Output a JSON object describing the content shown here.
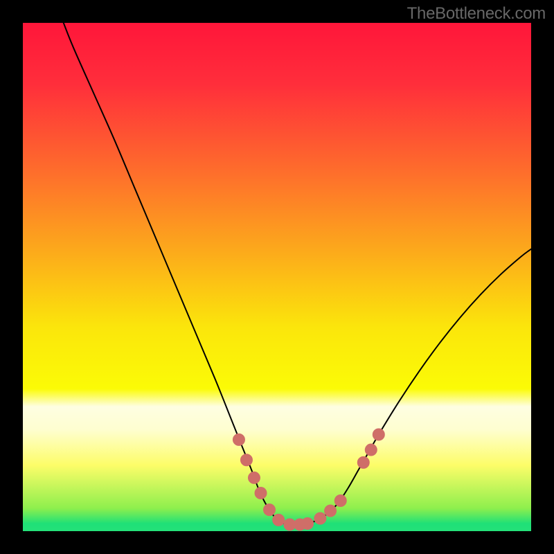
{
  "watermark": "TheBottleneck.com",
  "colors": {
    "frame": "#000000",
    "curve_stroke": "#000000",
    "marker_fill": "#cf6e68",
    "marker_stroke": "#cf6e68",
    "gradient_stops": [
      {
        "offset": 0.0,
        "color": "#ff163a"
      },
      {
        "offset": 0.12,
        "color": "#ff2e3b"
      },
      {
        "offset": 0.3,
        "color": "#fe702b"
      },
      {
        "offset": 0.46,
        "color": "#fcae1a"
      },
      {
        "offset": 0.6,
        "color": "#fbe60b"
      },
      {
        "offset": 0.72,
        "color": "#fbfb06"
      },
      {
        "offset": 0.755,
        "color": "#fefee2"
      },
      {
        "offset": 0.8,
        "color": "#fefed0"
      },
      {
        "offset": 0.87,
        "color": "#fdfd69"
      },
      {
        "offset": 0.955,
        "color": "#8eef4d"
      },
      {
        "offset": 0.985,
        "color": "#1fe077"
      },
      {
        "offset": 1.0,
        "color": "#24e179"
      }
    ]
  },
  "chart_data": {
    "type": "line",
    "title": "",
    "xlabel": "",
    "ylabel": "",
    "xlim": [
      0,
      100
    ],
    "ylim": [
      0,
      100
    ],
    "curve": [
      {
        "x": 8.0,
        "y": 100.0
      },
      {
        "x": 10.0,
        "y": 95.0
      },
      {
        "x": 14.0,
        "y": 86.0
      },
      {
        "x": 18.0,
        "y": 77.0
      },
      {
        "x": 22.0,
        "y": 67.5
      },
      {
        "x": 26.0,
        "y": 58.0
      },
      {
        "x": 30.0,
        "y": 48.5
      },
      {
        "x": 34.0,
        "y": 39.0
      },
      {
        "x": 38.0,
        "y": 29.5
      },
      {
        "x": 41.0,
        "y": 22.0
      },
      {
        "x": 43.0,
        "y": 17.0
      },
      {
        "x": 45.0,
        "y": 12.0
      },
      {
        "x": 46.5,
        "y": 8.0
      },
      {
        "x": 48.0,
        "y": 5.0
      },
      {
        "x": 50.0,
        "y": 2.3
      },
      {
        "x": 52.0,
        "y": 1.3
      },
      {
        "x": 54.0,
        "y": 1.3
      },
      {
        "x": 56.0,
        "y": 1.5
      },
      {
        "x": 58.0,
        "y": 2.2
      },
      {
        "x": 60.0,
        "y": 3.5
      },
      {
        "x": 62.0,
        "y": 5.5
      },
      {
        "x": 64.0,
        "y": 8.5
      },
      {
        "x": 66.0,
        "y": 12.0
      },
      {
        "x": 68.0,
        "y": 15.5
      },
      {
        "x": 70.0,
        "y": 19.0
      },
      {
        "x": 74.0,
        "y": 25.5
      },
      {
        "x": 78.0,
        "y": 31.5
      },
      {
        "x": 82.0,
        "y": 37.0
      },
      {
        "x": 86.0,
        "y": 42.0
      },
      {
        "x": 90.0,
        "y": 46.5
      },
      {
        "x": 94.0,
        "y": 50.5
      },
      {
        "x": 98.0,
        "y": 54.0
      },
      {
        "x": 100.0,
        "y": 55.5
      }
    ],
    "markers": [
      {
        "x": 42.5,
        "y": 18.0
      },
      {
        "x": 44.0,
        "y": 14.0
      },
      {
        "x": 45.5,
        "y": 10.5
      },
      {
        "x": 46.8,
        "y": 7.5
      },
      {
        "x": 48.5,
        "y": 4.2
      },
      {
        "x": 50.3,
        "y": 2.2
      },
      {
        "x": 52.5,
        "y": 1.3
      },
      {
        "x": 54.5,
        "y": 1.3
      },
      {
        "x": 56.0,
        "y": 1.5
      },
      {
        "x": 58.5,
        "y": 2.5
      },
      {
        "x": 60.5,
        "y": 4.0
      },
      {
        "x": 62.5,
        "y": 6.0
      },
      {
        "x": 67.0,
        "y": 13.5
      },
      {
        "x": 68.5,
        "y": 16.0
      },
      {
        "x": 70.0,
        "y": 19.0
      }
    ],
    "marker_radius_px": 8.5
  }
}
